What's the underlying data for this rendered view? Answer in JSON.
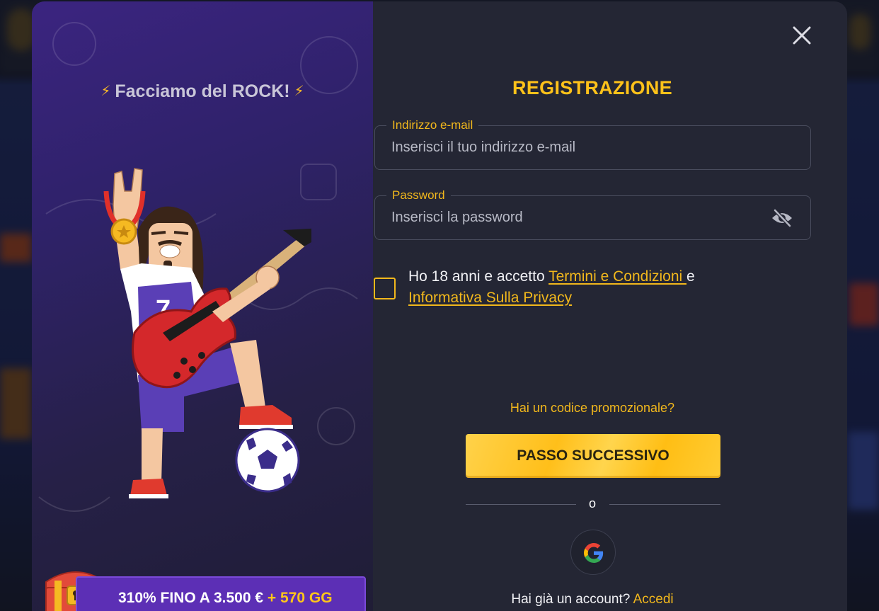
{
  "left_panel": {
    "tagline": "Facciamo del ROCK!",
    "bolt_glyph": "⚡",
    "jersey_number": "7",
    "promo": {
      "main": "310% FINO A 3.500 €",
      "extra": "+ 570 GG"
    }
  },
  "form": {
    "title": "REGISTRAZIONE",
    "email": {
      "label": "Indirizzo e-mail",
      "placeholder": "Inserisci il tuo indirizzo e-mail",
      "value": ""
    },
    "password": {
      "label": "Password",
      "placeholder": "Inserisci la password",
      "value": ""
    },
    "consent": {
      "prefix": "Ho 18 anni e accetto ",
      "terms_link": "Termini e Condizioni ",
      "middle": "e",
      "privacy_link": "Informativa Sulla Privacy",
      "checked": false
    },
    "promo_code_link": "Hai un codice promozionale?",
    "next_button": "PASSO SUCCESSIVO",
    "or_text": "o",
    "login_prompt": "Hai già un account?",
    "login_link": "Accedi"
  },
  "icons": {
    "close": "close-icon",
    "eye": "eye-slash-icon",
    "google": "google-icon",
    "bolt": "lightning-bolt-icon",
    "chest": "treasure-chest-icon"
  },
  "colors": {
    "accent": "#f2b81c",
    "modal_bg": "#242634",
    "banner_bg": "#5c2fb5"
  }
}
